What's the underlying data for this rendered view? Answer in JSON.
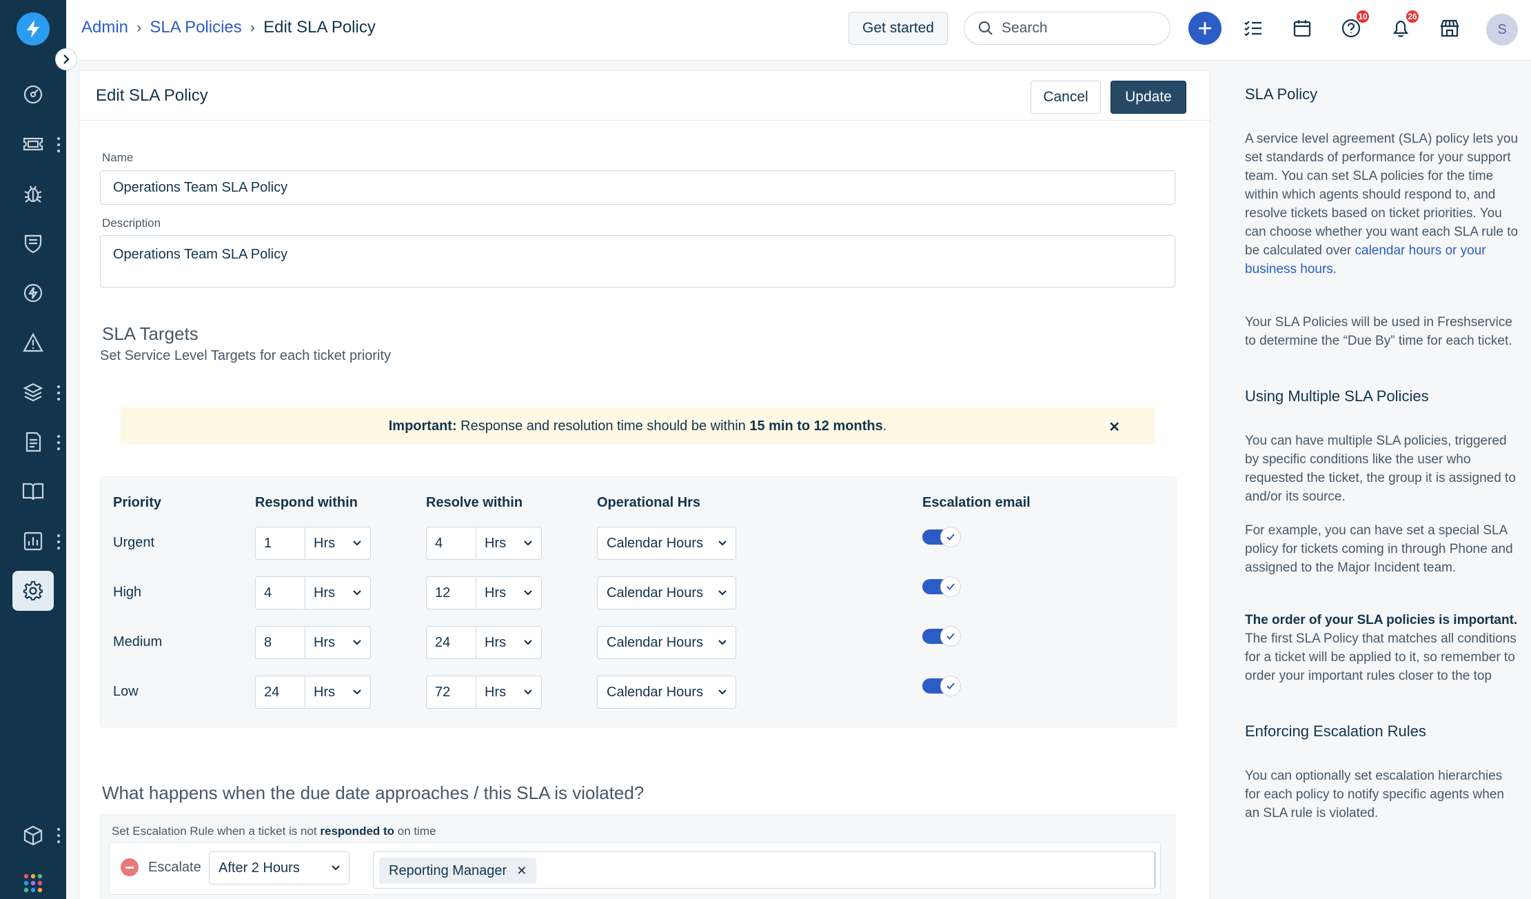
{
  "header": {
    "breadcrumb": [
      "Admin",
      "SLA Policies",
      "Edit SLA Policy"
    ],
    "get_started": "Get started",
    "search_placeholder": "Search",
    "badges": {
      "help": "10",
      "notifications": "26"
    },
    "avatar_initial": "S"
  },
  "card": {
    "title": "Edit SLA Policy",
    "cancel": "Cancel",
    "update": "Update"
  },
  "form": {
    "name_label": "Name",
    "name_value": "Operations Team SLA Policy",
    "description_label": "Description",
    "description_value": "Operations Team SLA Policy"
  },
  "targets": {
    "title": "SLA Targets",
    "subtitle": "Set Service Level Targets for each ticket priority",
    "notice_bold": "Important:",
    "notice_text": " Response and resolution time should be within ",
    "notice_range": "15 min to 12 months",
    "notice_end": ".",
    "headers": [
      "Priority",
      "Respond within",
      "Resolve within",
      "Operational Hrs",
      "Escalation email"
    ],
    "rows": [
      {
        "priority": "Urgent",
        "respond": "1",
        "respond_unit": "Hrs",
        "resolve": "4",
        "resolve_unit": "Hrs",
        "operational": "Calendar Hours",
        "escalation": true
      },
      {
        "priority": "High",
        "respond": "4",
        "respond_unit": "Hrs",
        "resolve": "12",
        "resolve_unit": "Hrs",
        "operational": "Calendar Hours",
        "escalation": true
      },
      {
        "priority": "Medium",
        "respond": "8",
        "respond_unit": "Hrs",
        "resolve": "24",
        "resolve_unit": "Hrs",
        "operational": "Calendar Hours",
        "escalation": true
      },
      {
        "priority": "Low",
        "respond": "24",
        "respond_unit": "Hrs",
        "resolve": "72",
        "resolve_unit": "Hrs",
        "operational": "Calendar Hours",
        "escalation": true
      }
    ]
  },
  "violation": {
    "title": "What happens when the due date approaches / this SLA is violated?",
    "rule_prefix": "Set Escalation Rule when a ticket is not ",
    "rule_bold": "responded to",
    "rule_suffix": " on time",
    "escalate_word": "Escalate",
    "after_value": "After 2 Hours",
    "tag": "Reporting Manager"
  },
  "help": {
    "h1": "SLA Policy",
    "p1": "A service level agreement (SLA) policy lets you set standards of performance for your support team. You can set SLA policies for the time within which agents should respond to, and resolve tickets based on ticket priorities. You can choose whether you want each SLA rule to be calculated over ",
    "p1_link": "calendar hours or your business hours.",
    "p2": "Your SLA Policies will be used in Freshservice to determine the “Due By” time for each ticket.",
    "h2": "Using Multiple SLA Policies",
    "p3": "You can have multiple SLA policies, triggered by specific conditions like the user who requested the ticket, the group it is assigned to and/or its source.",
    "p4": "For example, you can have set a special SLA policy for tickets coming in through Phone and assigned to the Major Incident team.",
    "p5_bold": "The order of your SLA policies is important.",
    "p5": " The first SLA Policy that matches all conditions for a ticket will be applied to it, so remember to order your important rules closer to the top",
    "h3": "Enforcing Escalation Rules",
    "p6": "You can optionally set escalation hierarchies for each policy to notify specific agents when an SLA rule is violated."
  },
  "colors": {
    "sidebar": "#12344d",
    "primary": "#2c5cc5",
    "update_button": "#264966",
    "notice": "#fef8e4",
    "badge": "#e43538"
  },
  "icons": [
    "lightning-logo-icon",
    "dashboard-icon",
    "ticket-icon",
    "bug-icon",
    "shield-icon",
    "bolt-icon",
    "alert-icon",
    "layers-icon",
    "document-icon",
    "book-icon",
    "reports-icon",
    "settings-icon",
    "box-icon",
    "apps-grid-icon"
  ]
}
